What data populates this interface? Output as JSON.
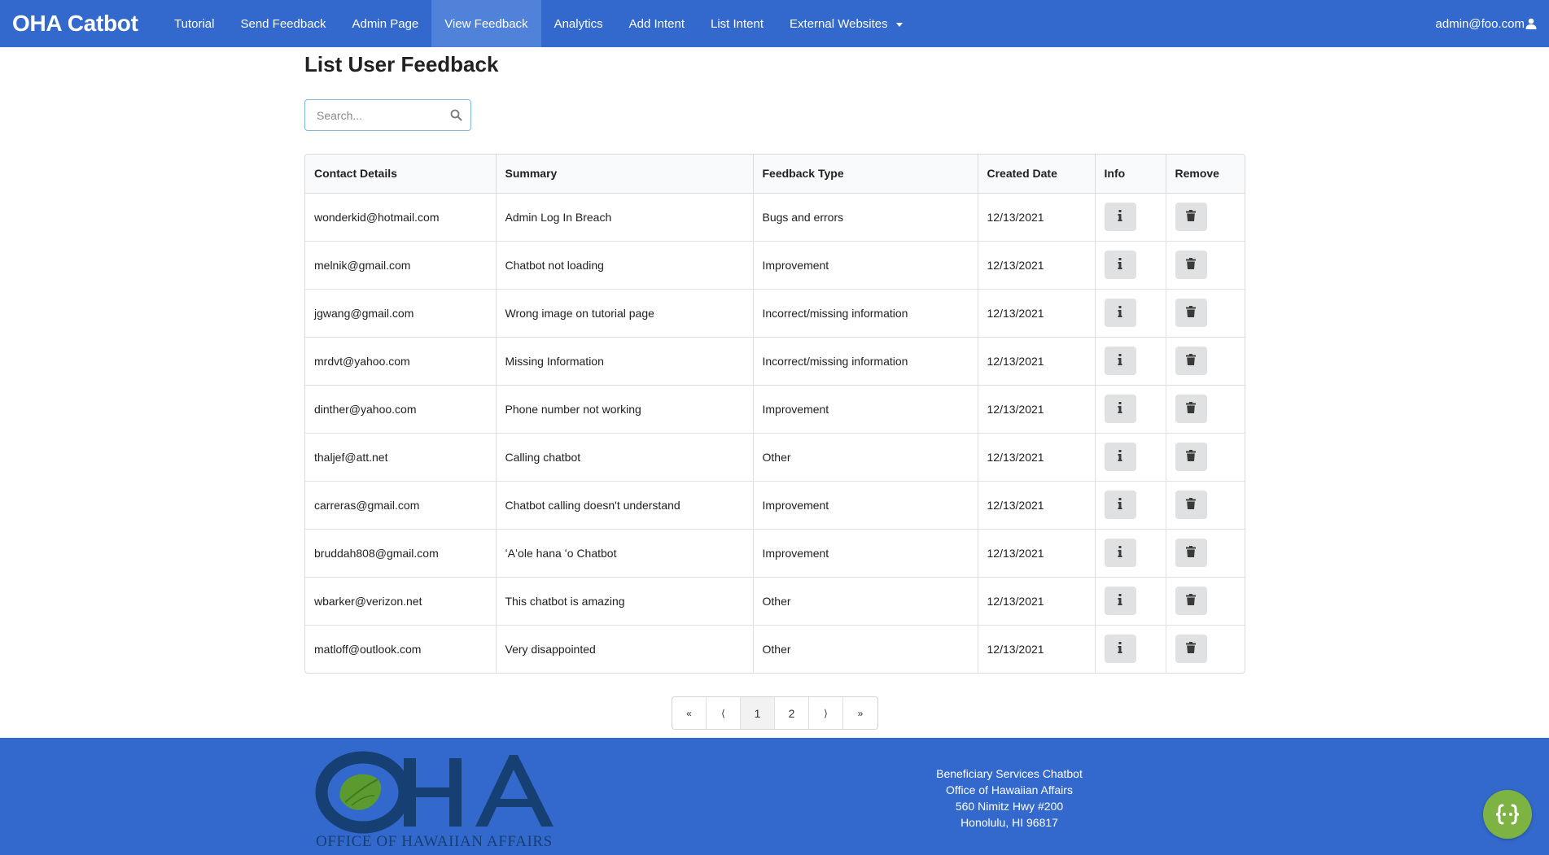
{
  "navbar": {
    "brand": "OHA Catbot",
    "items": [
      {
        "label": "Tutorial"
      },
      {
        "label": "Send Feedback"
      },
      {
        "label": "Admin Page"
      },
      {
        "label": "View Feedback"
      },
      {
        "label": "Analytics"
      },
      {
        "label": "Add Intent"
      },
      {
        "label": "List Intent"
      },
      {
        "label": "External Websites"
      }
    ],
    "active_index": 3,
    "user": "admin@foo.com"
  },
  "main": {
    "title": "List User Feedback",
    "search": {
      "placeholder": "Search...",
      "value": ""
    }
  },
  "table": {
    "headers": [
      "Contact Details",
      "Summary",
      "Feedback Type",
      "Created Date",
      "Info",
      "Remove"
    ],
    "rows": [
      {
        "contact": "wonderkid@hotmail.com",
        "summary": "Admin Log In Breach",
        "type": "Bugs and errors",
        "date": "12/13/2021"
      },
      {
        "contact": "melnik@gmail.com",
        "summary": "Chatbot not loading",
        "type": "Improvement",
        "date": "12/13/2021"
      },
      {
        "contact": "jgwang@gmail.com",
        "summary": "Wrong image on tutorial page",
        "type": "Incorrect/missing information",
        "date": "12/13/2021"
      },
      {
        "contact": "mrdvt@yahoo.com",
        "summary": "Missing Information",
        "type": "Incorrect/missing information",
        "date": "12/13/2021"
      },
      {
        "contact": "dinther@yahoo.com",
        "summary": "Phone number not working",
        "type": "Improvement",
        "date": "12/13/2021"
      },
      {
        "contact": "thaljef@att.net",
        "summary": "Calling chatbot",
        "type": "Other",
        "date": "12/13/2021"
      },
      {
        "contact": "carreras@gmail.com",
        "summary": "Chatbot calling doesn't understand",
        "type": "Improvement",
        "date": "12/13/2021"
      },
      {
        "contact": "bruddah808@gmail.com",
        "summary": "ʻAʻole hana ʻo Chatbot",
        "type": "Improvement",
        "date": "12/13/2021"
      },
      {
        "contact": "wbarker@verizon.net",
        "summary": "This chatbot is amazing",
        "type": "Other",
        "date": "12/13/2021"
      },
      {
        "contact": "matloff@outlook.com",
        "summary": "Very disappointed",
        "type": "Other",
        "date": "12/13/2021"
      }
    ],
    "info_icon": "info-icon",
    "remove_icon": "trash-icon"
  },
  "pagination": {
    "first": "«",
    "prev": "⟨",
    "pages": [
      "1",
      "2"
    ],
    "current": "1",
    "next": "⟩",
    "last": "»"
  },
  "footer": {
    "address_lines": [
      "Beneficiary Services Chatbot",
      "Office of Hawaiian Affairs",
      "560 Nimitz Hwy #200",
      "Honolulu, HI 96817"
    ],
    "logo_text": "OHA",
    "logo_subtext": "OFFICE OF HAWAIIAN AFFAIRS"
  },
  "colors": {
    "navbar": "#3369cc",
    "nav_active": "#4f82d8",
    "footer": "#3369cc",
    "logo_navy": "#163f73",
    "logo_leaf": "#5a9a2e",
    "chat_fab": "#7cb342"
  }
}
